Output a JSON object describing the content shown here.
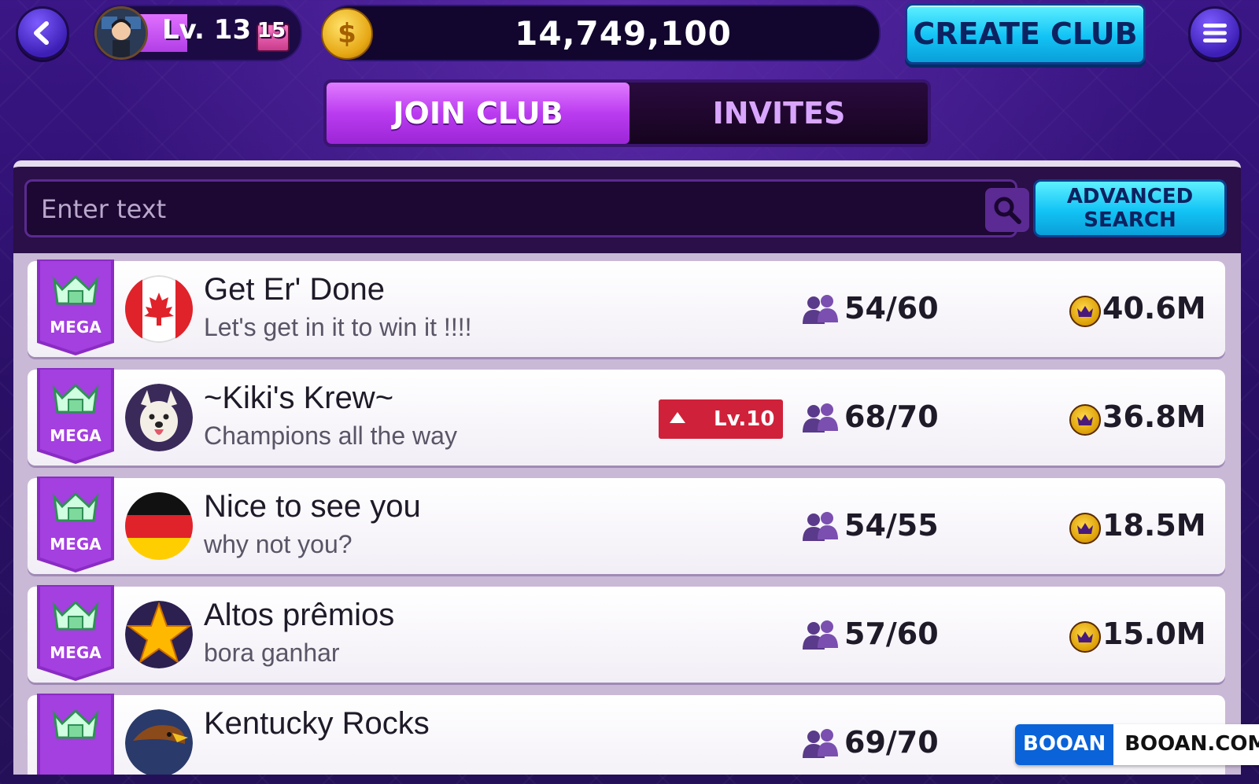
{
  "header": {
    "back_icon": "back-arrow-icon",
    "level_label": "Lv. 13",
    "gift_count": "15",
    "coins": "14,749,100",
    "create_club_label": "CREATE CLUB",
    "menu_icon": "hamburger-menu-icon"
  },
  "tabs": [
    {
      "label": "JOIN CLUB",
      "active": true
    },
    {
      "label": "INVITES",
      "active": false
    }
  ],
  "search": {
    "placeholder": "Enter text",
    "value": "",
    "advanced_label": "ADVANCED SEARCH"
  },
  "clubs": [
    {
      "badge": "MEGA",
      "flag": "canada",
      "name": "Get Er' Done",
      "motto": "Let's get in it to win it !!!!",
      "members": "54/60",
      "points": "40.6M",
      "level_req": ""
    },
    {
      "badge": "MEGA",
      "flag": "westie-dog",
      "name": "~Kiki's Krew~",
      "motto": "Champions all the way",
      "members": "68/70",
      "points": "36.8M",
      "level_req": "Lv.10"
    },
    {
      "badge": "MEGA",
      "flag": "germany",
      "name": "Nice to see you",
      "motto": "why not you?",
      "members": "54/55",
      "points": "18.5M",
      "level_req": ""
    },
    {
      "badge": "MEGA",
      "flag": "gold-star",
      "name": "Altos prêmios",
      "motto": "bora ganhar",
      "members": "57/60",
      "points": "15.0M",
      "level_req": ""
    },
    {
      "badge": "",
      "flag": "eagle",
      "name": "Kentucky Rocks",
      "motto": "",
      "members": "69/70",
      "points": "",
      "level_req": ""
    }
  ],
  "watermark": {
    "left": "BOOAN",
    "right": "BOOAN.COM"
  },
  "colors": {
    "accent_cyan": "#12c3f5",
    "accent_purple": "#bb3cf0",
    "level_req_red": "#d0213a"
  }
}
